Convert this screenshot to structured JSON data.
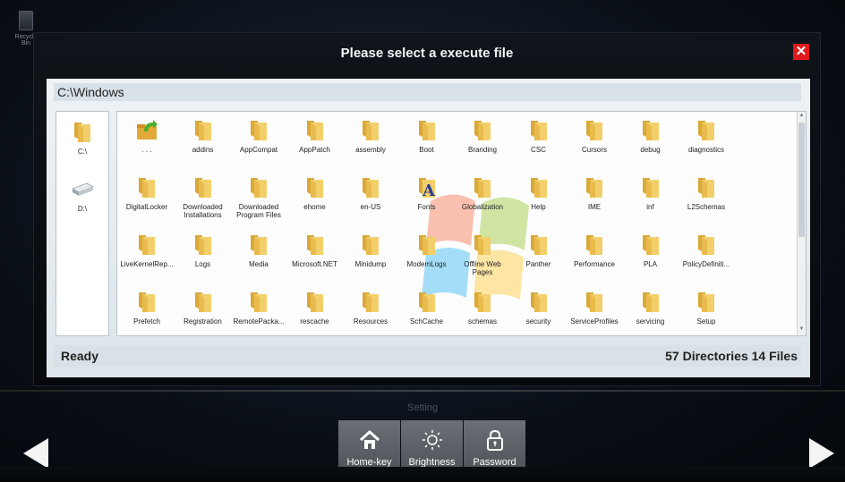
{
  "desktop": {
    "recycle_label": "Recycle Bin"
  },
  "dialog": {
    "title": "Please select a execute file",
    "close_symbol": "✕",
    "path": "C:\\Windows",
    "drives": [
      {
        "label": "C:\\",
        "icon": "folder-icon"
      },
      {
        "label": "D:\\",
        "icon": "disk-drive-icon"
      }
    ],
    "items": [
      {
        "label": ". . .",
        "icon": "folder-up-icon"
      },
      {
        "label": "addins",
        "icon": "folder-icon"
      },
      {
        "label": "AppCompat",
        "icon": "folder-icon"
      },
      {
        "label": "AppPatch",
        "icon": "folder-icon"
      },
      {
        "label": "assembly",
        "icon": "folder-icon"
      },
      {
        "label": "Boot",
        "icon": "folder-icon"
      },
      {
        "label": "Branding",
        "icon": "folder-icon"
      },
      {
        "label": "CSC",
        "icon": "folder-icon"
      },
      {
        "label": "Cursors",
        "icon": "folder-icon"
      },
      {
        "label": "debug",
        "icon": "folder-icon"
      },
      {
        "label": "diagnostics",
        "icon": "folder-icon"
      },
      {
        "label": "DigitalLocker",
        "icon": "folder-icon"
      },
      {
        "label": "Downloaded Installations",
        "icon": "folder-icon"
      },
      {
        "label": "Downloaded Program Files",
        "icon": "folder-icon"
      },
      {
        "label": "ehome",
        "icon": "folder-icon"
      },
      {
        "label": "en-US",
        "icon": "folder-icon"
      },
      {
        "label": "Fonts",
        "icon": "fonts-folder-icon"
      },
      {
        "label": "Globalization",
        "icon": "folder-icon"
      },
      {
        "label": "Help",
        "icon": "folder-icon"
      },
      {
        "label": "IME",
        "icon": "folder-icon"
      },
      {
        "label": "inf",
        "icon": "folder-icon"
      },
      {
        "label": "L2Schemas",
        "icon": "folder-icon"
      },
      {
        "label": "LiveKernelRep...",
        "icon": "folder-icon"
      },
      {
        "label": "Logs",
        "icon": "folder-icon"
      },
      {
        "label": "Media",
        "icon": "folder-icon"
      },
      {
        "label": "Microsoft.NET",
        "icon": "folder-icon"
      },
      {
        "label": "Minidump",
        "icon": "folder-icon"
      },
      {
        "label": "ModemLogs",
        "icon": "folder-icon"
      },
      {
        "label": "Offline Web Pages",
        "icon": "folder-icon"
      },
      {
        "label": "Panther",
        "icon": "folder-icon"
      },
      {
        "label": "Performance",
        "icon": "folder-icon"
      },
      {
        "label": "PLA",
        "icon": "folder-icon"
      },
      {
        "label": "PolicyDefiniti...",
        "icon": "folder-icon"
      },
      {
        "label": "Prefetch",
        "icon": "folder-icon"
      },
      {
        "label": "Registration",
        "icon": "folder-icon"
      },
      {
        "label": "RemotePacka...",
        "icon": "folder-icon"
      },
      {
        "label": "rescache",
        "icon": "folder-icon"
      },
      {
        "label": "Resources",
        "icon": "folder-icon"
      },
      {
        "label": "SchCache",
        "icon": "folder-icon"
      },
      {
        "label": "schemas",
        "icon": "folder-icon"
      },
      {
        "label": "security",
        "icon": "folder-icon"
      },
      {
        "label": "ServiceProfiles",
        "icon": "folder-icon"
      },
      {
        "label": "servicing",
        "icon": "folder-icon"
      },
      {
        "label": "Setup",
        "icon": "folder-icon"
      }
    ],
    "status_left": "Ready",
    "status_right": "57 Directories 14 Files"
  },
  "settings": {
    "label": "Setting",
    "buttons": [
      {
        "label": "Home-key",
        "icon": "home-icon"
      },
      {
        "label": "Brightness",
        "icon": "brightness-icon"
      },
      {
        "label": "Password",
        "icon": "lock-icon"
      }
    ]
  },
  "colors": {
    "folder": "#f2cf6a",
    "folder_dark": "#d9a93a",
    "close_red": "#e11b1b"
  }
}
